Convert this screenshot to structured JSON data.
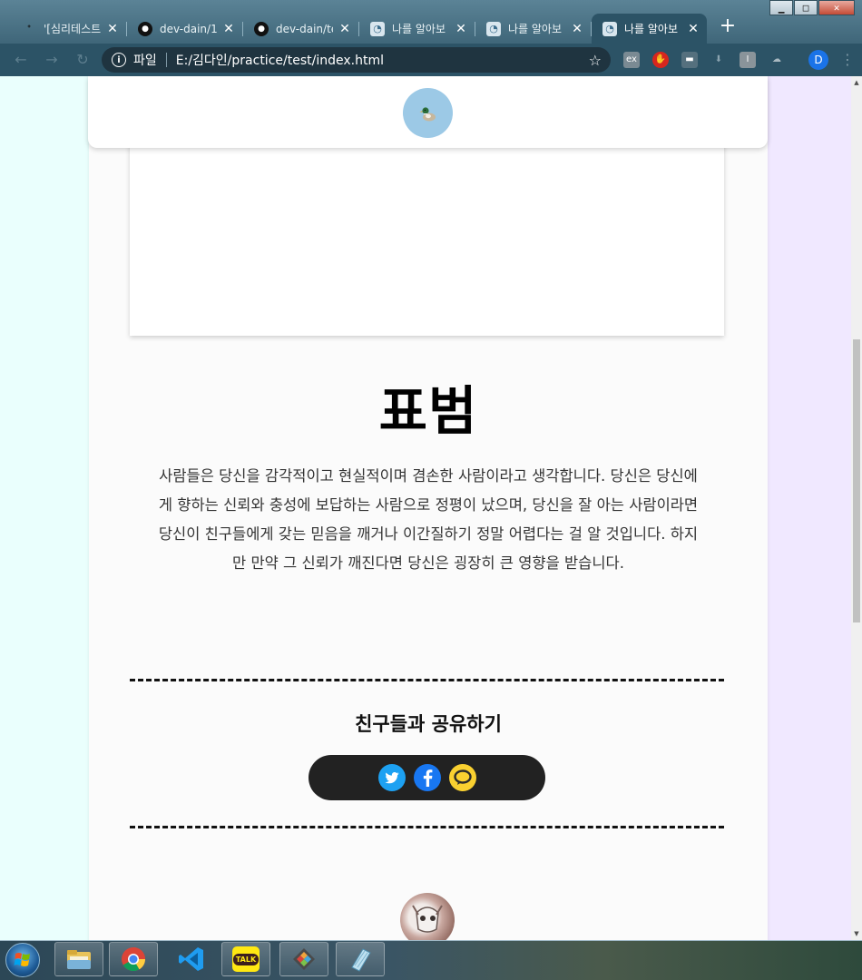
{
  "browser": {
    "tabs": [
      {
        "label": "'[심리테스트",
        "icon": "testbook-favicon",
        "active": false
      },
      {
        "label": "dev-dain/1(",
        "icon": "github-icon",
        "active": false
      },
      {
        "label": "dev-dain/te",
        "icon": "github-icon",
        "active": false
      },
      {
        "label": "나를 알아보",
        "icon": "page-favicon",
        "active": false
      },
      {
        "label": "나를 알아보",
        "icon": "page-favicon",
        "active": false
      },
      {
        "label": "나를 알아보",
        "icon": "page-favicon",
        "active": true
      }
    ],
    "address": {
      "file_label": "파일",
      "url": "E:/김다인/practice/test/index.html"
    },
    "profile_initial": "D",
    "extensions": [
      "ex",
      "red-hand",
      "ext",
      "download",
      "I",
      "cloud"
    ]
  },
  "page": {
    "result_title": "표범",
    "result_description": "사람들은 당신을 감각적이고 현실적이며 겸손한 사람이라고 생각합니다. 당신은 당신에게 향하는 신뢰와 충성에 보답하는 사람으로 정평이 났으며, 당신을 잘 아는 사람이라면 당신이 친구들에게 갖는 믿음을 깨거나 이간질하기 정말 어렵다는 걸 알 것입니다. 하지만 만약 그 신뢰가 깨진다면 당신은 굉장히 큰 영향을 받습니다.",
    "share_title": "친구들과 공유하기",
    "share_buttons": [
      "twitter-icon",
      "facebook-icon",
      "kakaotalk-icon"
    ]
  },
  "taskbar": {
    "apps": [
      "windows-explorer",
      "chrome",
      "vscode",
      "kakaotalk",
      "git-tool",
      "notepad"
    ],
    "kakaotalk_label": "TALK"
  },
  "colors": {
    "left_bg": "#eafffd",
    "right_bg": "#f0e8ff",
    "share_bar": "#222222",
    "twitter": "#1da1f2",
    "facebook": "#1877f2",
    "kakao": "#f9d030"
  }
}
